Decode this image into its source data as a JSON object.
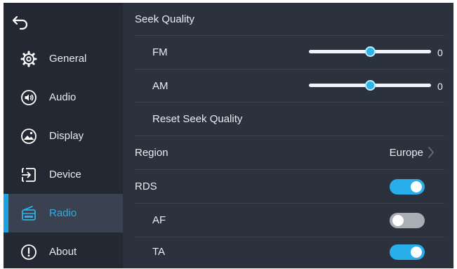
{
  "sidebar": {
    "back_icon": "back-arrow-icon",
    "items": [
      {
        "label": "General",
        "icon": "gear-icon",
        "active": false
      },
      {
        "label": "Audio",
        "icon": "speaker-icon",
        "active": false
      },
      {
        "label": "Display",
        "icon": "display-icon",
        "active": false
      },
      {
        "label": "Device",
        "icon": "device-icon",
        "active": false
      },
      {
        "label": "Radio",
        "icon": "radio-icon",
        "active": true
      },
      {
        "label": "About",
        "icon": "info-icon",
        "active": false
      }
    ]
  },
  "main": {
    "seek_quality": {
      "title": "Seek Quality",
      "fm": {
        "label": "FM",
        "value": "0",
        "level": 0.5
      },
      "am": {
        "label": "AM",
        "value": "0",
        "level": 0.5
      },
      "reset_label": "Reset Seek Quality"
    },
    "region": {
      "label": "Region",
      "value": "Europe"
    },
    "rds": {
      "label": "RDS",
      "on": true
    },
    "af": {
      "label": "AF",
      "on": false
    },
    "ta": {
      "label": "TA",
      "on": true
    }
  },
  "colors": {
    "accent": "#1aa3e0",
    "background": "#2b313d",
    "sidebar": "#232833",
    "toggle_off": "#a9adb4"
  }
}
